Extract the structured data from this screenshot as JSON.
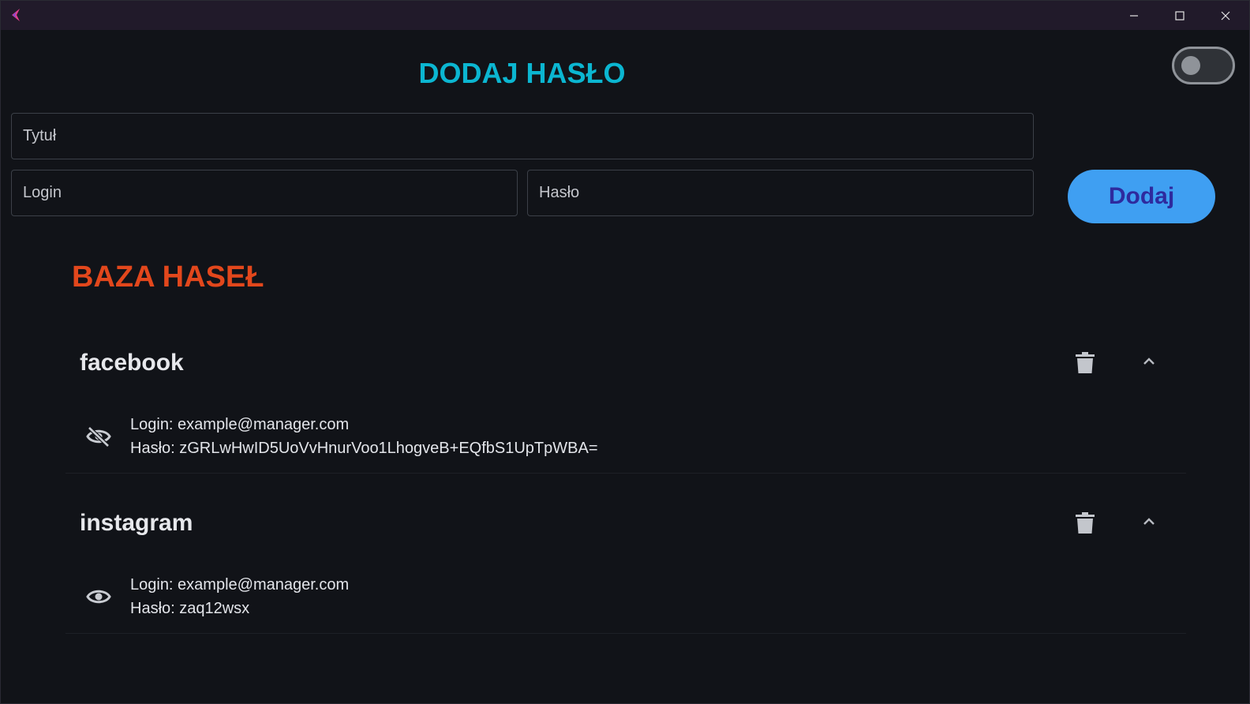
{
  "window": {
    "icons": [
      "app-logo-icon",
      "minimize-icon",
      "maximize-icon",
      "close-icon"
    ]
  },
  "theme_toggle": {
    "state": "off"
  },
  "add_section": {
    "title": "DODAJ HASŁO",
    "title_placeholder": "Tytuł",
    "login_placeholder": "Login",
    "password_placeholder": "Hasło",
    "add_button_label": "Dodaj"
  },
  "database": {
    "title": "BAZA HASEŁ",
    "entries": [
      {
        "name": "facebook",
        "login_line": "Login: example@manager.com",
        "password_line": "Hasło: zGRLwHwID5UoVvHnurVoo1LhogveB+EQfbS1UpTpWBA=",
        "visibility_icon": "eye-off-icon"
      },
      {
        "name": "instagram",
        "login_line": "Login: example@manager.com",
        "password_line": "Hasło: zaq12wsx",
        "visibility_icon": "eye-icon"
      }
    ]
  },
  "colors": {
    "background": "#111318",
    "titlebar": "#211a2a",
    "add_title": "#0bb6d1",
    "database_title": "#e2471c",
    "add_button_bg": "#3f9ff2",
    "add_button_text": "#2e2a9e"
  }
}
